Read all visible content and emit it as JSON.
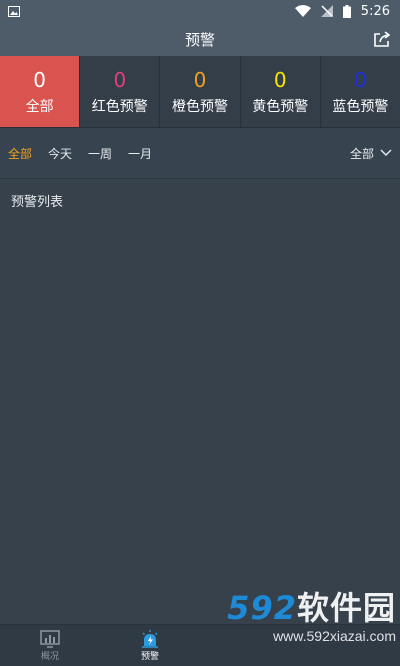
{
  "status_bar": {
    "time": "5:26",
    "icons": [
      "image-icon",
      "wifi-icon",
      "signal-off-icon",
      "battery-icon"
    ]
  },
  "app_bar": {
    "title": "预警",
    "share_icon": "share-icon"
  },
  "levels": [
    {
      "count": "0",
      "label": "全部",
      "color": "#ffffff"
    },
    {
      "count": "0",
      "label": "红色预警",
      "color": "#e0407a"
    },
    {
      "count": "0",
      "label": "橙色预警",
      "color": "#f0a020"
    },
    {
      "count": "0",
      "label": "黄色预警",
      "color": "#f5e600"
    },
    {
      "count": "0",
      "label": "蓝色预警",
      "color": "#1a2ee0"
    }
  ],
  "filters": {
    "ranges": [
      "全部",
      "今天",
      "一周",
      "一月"
    ],
    "active_range": "全部",
    "scope": "全部"
  },
  "list": {
    "title": "预警列表"
  },
  "tabbar": {
    "items": [
      {
        "label": "概况",
        "icon": "chart-icon"
      },
      {
        "label": "预警",
        "icon": "alarm-icon"
      }
    ]
  },
  "watermark": {
    "number": "592",
    "text": "软件园",
    "url": "www.592xiazai.com"
  },
  "colors": {
    "accent": "#f0a020",
    "active_level_bg": "#d9534f",
    "header_bg": "#4e5c69",
    "page_bg": "#37434e"
  }
}
